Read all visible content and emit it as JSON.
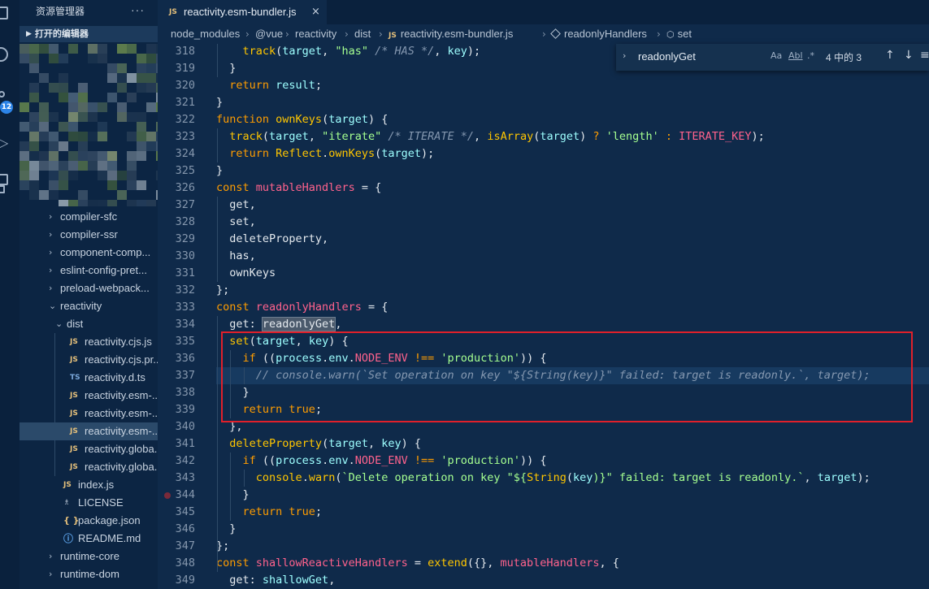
{
  "activity_bar": {
    "badge": "12"
  },
  "sidebar": {
    "title": "资源管理器",
    "more": "···",
    "section": "打开的编辑器",
    "tree": [
      {
        "label": "compiler-sfc",
        "type": "folder",
        "depth": 0
      },
      {
        "label": "compiler-ssr",
        "type": "folder",
        "depth": 0
      },
      {
        "label": "component-comp...",
        "type": "folder",
        "depth": 0
      },
      {
        "label": "eslint-config-pret...",
        "type": "folder",
        "depth": 0
      },
      {
        "label": "preload-webpack...",
        "type": "folder",
        "depth": 0
      },
      {
        "label": "reactivity",
        "type": "folder-open",
        "depth": 0
      },
      {
        "label": "dist",
        "type": "folder-open",
        "depth": 1
      },
      {
        "label": "reactivity.cjs.js",
        "type": "js",
        "depth": 2
      },
      {
        "label": "reactivity.cjs.pr...",
        "type": "js",
        "depth": 2
      },
      {
        "label": "reactivity.d.ts",
        "type": "ts",
        "depth": 2
      },
      {
        "label": "reactivity.esm-...",
        "type": "js",
        "depth": 2
      },
      {
        "label": "reactivity.esm-...",
        "type": "js",
        "depth": 2
      },
      {
        "label": "reactivity.esm-...",
        "type": "js",
        "depth": 2,
        "selected": true
      },
      {
        "label": "reactivity.globa...",
        "type": "js",
        "depth": 2
      },
      {
        "label": "reactivity.globa...",
        "type": "js",
        "depth": 2
      },
      {
        "label": "index.js",
        "type": "js",
        "depth": 1
      },
      {
        "label": "LICENSE",
        "type": "license",
        "depth": 1
      },
      {
        "label": "package.json",
        "type": "json",
        "depth": 1
      },
      {
        "label": "README.md",
        "type": "info",
        "depth": 1
      },
      {
        "label": "runtime-core",
        "type": "folder",
        "depth": 0
      },
      {
        "label": "runtime-dom",
        "type": "folder",
        "depth": 0
      }
    ],
    "icon_glyphs": {
      "js": "JS",
      "ts": "TS",
      "license": "♗",
      "json": "{ }",
      "info": "ⓘ",
      "folder": "›",
      "folder-open": "⌄"
    }
  },
  "tab": {
    "lang": "JS",
    "name": "reactivity.esm-bundler.js",
    "close": "×"
  },
  "breadcrumb": {
    "items": [
      "node_modules",
      "@vue",
      "reactivity",
      "dist",
      "reactivity.esm-bundler.js",
      "readonlyHandlers",
      "set"
    ],
    "js_tag": "JS",
    "fn_tag": "{}",
    "sep": "›"
  },
  "find": {
    "query": "readonlyGet",
    "opt_case": "Aa",
    "opt_word": "Abl",
    "opt_regex": ".*",
    "count": "4 中的 3",
    "up": "↑",
    "down": "↓",
    "menu": "≡"
  },
  "editor": {
    "current_line": 337,
    "breakpoint_line": 344,
    "lines": [
      {
        "n": "318",
        "t": [
          [
            "    ",
            "nm"
          ],
          [
            "track",
            "fn"
          ],
          [
            "(",
            "nm"
          ],
          [
            "target",
            "vr"
          ],
          [
            ", ",
            "nm"
          ],
          [
            "\"has\"",
            "st"
          ],
          [
            " /* HAS */",
            "cm"
          ],
          [
            ", ",
            "nm"
          ],
          [
            "key",
            "vr"
          ],
          [
            ");",
            "nm"
          ]
        ]
      },
      {
        "n": "319",
        "t": [
          [
            "  }",
            "nm"
          ]
        ]
      },
      {
        "n": "320",
        "t": [
          [
            "  ",
            "nm"
          ],
          [
            "return ",
            "kw"
          ],
          [
            "result",
            "vr"
          ],
          [
            ";",
            "nm"
          ]
        ]
      },
      {
        "n": "321",
        "t": [
          [
            "}",
            "nm"
          ]
        ]
      },
      {
        "n": "322",
        "t": [
          [
            "function ",
            "kw"
          ],
          [
            "ownKeys",
            "fn"
          ],
          [
            "(",
            "nm"
          ],
          [
            "target",
            "vr"
          ],
          [
            ") {",
            "nm"
          ]
        ]
      },
      {
        "n": "323",
        "t": [
          [
            "  ",
            "nm"
          ],
          [
            "track",
            "fn"
          ],
          [
            "(",
            "nm"
          ],
          [
            "target",
            "vr"
          ],
          [
            ", ",
            "nm"
          ],
          [
            "\"iterate\"",
            "st"
          ],
          [
            " /* ITERATE */",
            "cm"
          ],
          [
            ", ",
            "nm"
          ],
          [
            "isArray",
            "fn"
          ],
          [
            "(",
            "nm"
          ],
          [
            "target",
            "vr"
          ],
          [
            ") ",
            "nm"
          ],
          [
            "? ",
            "op"
          ],
          [
            "'length'",
            "st"
          ],
          [
            " : ",
            "op"
          ],
          [
            "ITERATE_KEY",
            "cn"
          ],
          [
            ");",
            "nm"
          ]
        ]
      },
      {
        "n": "324",
        "t": [
          [
            "  ",
            "nm"
          ],
          [
            "return ",
            "kw"
          ],
          [
            "Reflect",
            "fn"
          ],
          [
            ".",
            "nm"
          ],
          [
            "ownKeys",
            "fn"
          ],
          [
            "(",
            "nm"
          ],
          [
            "target",
            "vr"
          ],
          [
            ");",
            "nm"
          ]
        ]
      },
      {
        "n": "325",
        "t": [
          [
            "}",
            "nm"
          ]
        ]
      },
      {
        "n": "326",
        "t": [
          [
            "const ",
            "kw"
          ],
          [
            "mutableHandlers",
            "cn"
          ],
          [
            " = {",
            "nm"
          ]
        ]
      },
      {
        "n": "327",
        "t": [
          [
            "  get,",
            "nm"
          ]
        ]
      },
      {
        "n": "328",
        "t": [
          [
            "  set,",
            "nm"
          ]
        ]
      },
      {
        "n": "329",
        "t": [
          [
            "  deleteProperty,",
            "nm"
          ]
        ]
      },
      {
        "n": "330",
        "t": [
          [
            "  has,",
            "nm"
          ]
        ]
      },
      {
        "n": "331",
        "t": [
          [
            "  ownKeys",
            "nm"
          ]
        ]
      },
      {
        "n": "332",
        "t": [
          [
            "};",
            "nm"
          ]
        ]
      },
      {
        "n": "333",
        "t": [
          [
            "const ",
            "kw"
          ],
          [
            "readonlyHandlers",
            "cn"
          ],
          [
            " = {",
            "nm"
          ]
        ]
      },
      {
        "n": "334",
        "t": [
          [
            "  get: ",
            "nm"
          ],
          [
            "readonlyGet",
            "hl"
          ],
          [
            ",",
            "nm"
          ]
        ]
      },
      {
        "n": "335",
        "t": [
          [
            "  ",
            "nm"
          ],
          [
            "set",
            "fn"
          ],
          [
            "(",
            "nm"
          ],
          [
            "target",
            "vr"
          ],
          [
            ", ",
            "nm"
          ],
          [
            "key",
            "vr"
          ],
          [
            ") {",
            "nm"
          ]
        ]
      },
      {
        "n": "336",
        "t": [
          [
            "    ",
            "nm"
          ],
          [
            "if ",
            "kw"
          ],
          [
            "((",
            "nm"
          ],
          [
            "process",
            "vr"
          ],
          [
            ".",
            "nm"
          ],
          [
            "env",
            "pr"
          ],
          [
            ".",
            "nm"
          ],
          [
            "NODE_ENV",
            "cn"
          ],
          [
            " !== ",
            "op"
          ],
          [
            "'production'",
            "st"
          ],
          [
            ")) {",
            "nm"
          ]
        ]
      },
      {
        "n": "337",
        "t": [
          [
            "      // console.warn(`Set operation on key \"${String(key)}\" failed: target is readonly.`, target);",
            "cm"
          ]
        ]
      },
      {
        "n": "338",
        "t": [
          [
            "    }",
            "nm"
          ]
        ]
      },
      {
        "n": "339",
        "t": [
          [
            "    ",
            "nm"
          ],
          [
            "return ",
            "kw"
          ],
          [
            "true",
            "kw2"
          ],
          [
            ";",
            "nm"
          ]
        ]
      },
      {
        "n": "340",
        "t": [
          [
            "  },",
            "nm"
          ]
        ]
      },
      {
        "n": "341",
        "t": [
          [
            "  ",
            "nm"
          ],
          [
            "deleteProperty",
            "fn"
          ],
          [
            "(",
            "nm"
          ],
          [
            "target",
            "vr"
          ],
          [
            ", ",
            "nm"
          ],
          [
            "key",
            "vr"
          ],
          [
            ") {",
            "nm"
          ]
        ]
      },
      {
        "n": "342",
        "t": [
          [
            "    ",
            "nm"
          ],
          [
            "if ",
            "kw"
          ],
          [
            "((",
            "nm"
          ],
          [
            "process",
            "vr"
          ],
          [
            ".",
            "nm"
          ],
          [
            "env",
            "pr"
          ],
          [
            ".",
            "nm"
          ],
          [
            "NODE_ENV",
            "cn"
          ],
          [
            " !== ",
            "op"
          ],
          [
            "'production'",
            "st"
          ],
          [
            ")) {",
            "nm"
          ]
        ]
      },
      {
        "n": "343",
        "t": [
          [
            "      ",
            "nm"
          ],
          [
            "console",
            "fn"
          ],
          [
            ".",
            "nm"
          ],
          [
            "warn",
            "fn"
          ],
          [
            "(",
            "nm"
          ],
          [
            "`Delete operation on key \"${",
            "st"
          ],
          [
            "String",
            "fn"
          ],
          [
            "(",
            "nm"
          ],
          [
            "key",
            "vr"
          ],
          [
            ")}\" failed: target is readonly.`",
            "st"
          ],
          [
            ", ",
            "nm"
          ],
          [
            "target",
            "vr"
          ],
          [
            ");",
            "nm"
          ]
        ]
      },
      {
        "n": "344",
        "t": [
          [
            "    }",
            "nm"
          ]
        ]
      },
      {
        "n": "345",
        "t": [
          [
            "    ",
            "nm"
          ],
          [
            "return ",
            "kw"
          ],
          [
            "true",
            "kw2"
          ],
          [
            ";",
            "nm"
          ]
        ]
      },
      {
        "n": "346",
        "t": [
          [
            "  }",
            "nm"
          ]
        ]
      },
      {
        "n": "347",
        "t": [
          [
            "};",
            "nm"
          ]
        ]
      },
      {
        "n": "348",
        "t": [
          [
            "const ",
            "kw"
          ],
          [
            "shallowReactiveHandlers",
            "cn"
          ],
          [
            " = ",
            "nm"
          ],
          [
            "extend",
            "fn"
          ],
          [
            "({}, ",
            "nm"
          ],
          [
            "mutableHandlers",
            "cn"
          ],
          [
            ", {",
            "nm"
          ]
        ]
      },
      {
        "n": "349",
        "t": [
          [
            "  get: ",
            "nm"
          ],
          [
            "shallowGet",
            "vr"
          ],
          [
            ",",
            "nm"
          ]
        ]
      }
    ]
  }
}
